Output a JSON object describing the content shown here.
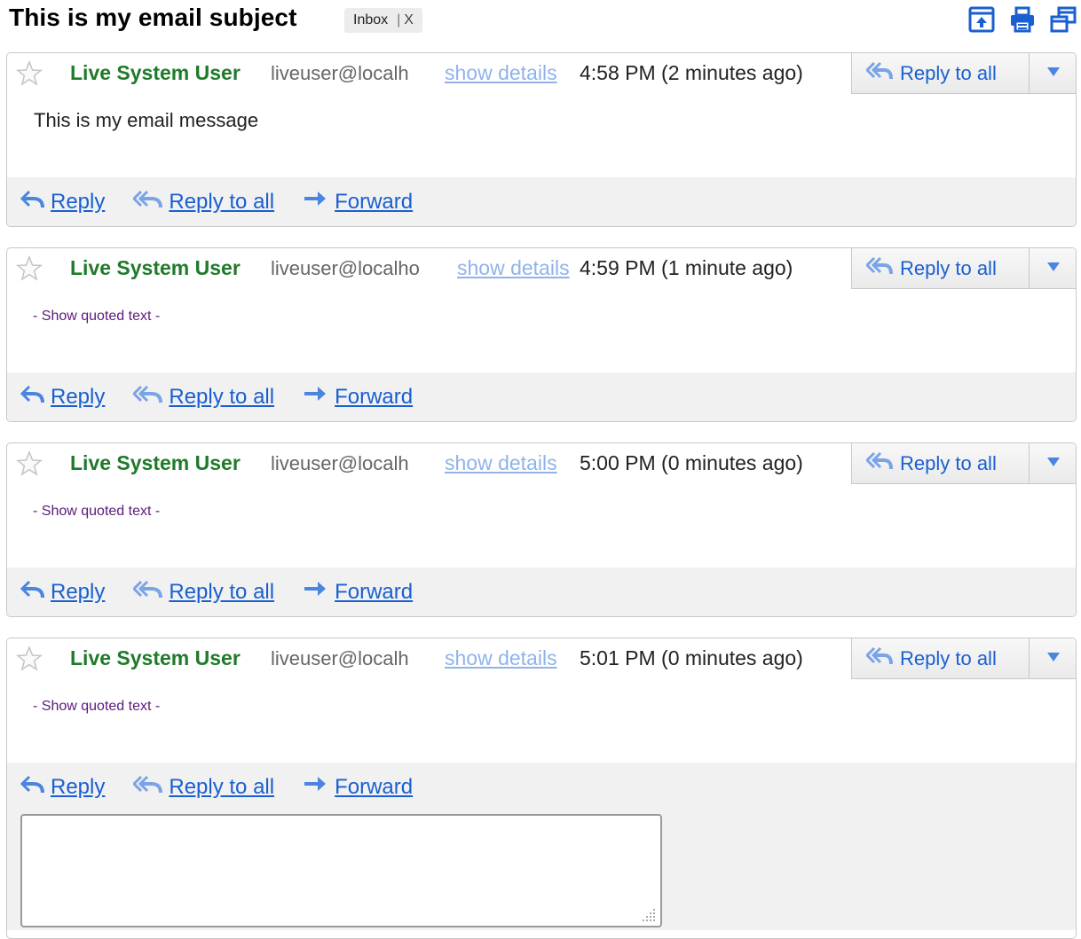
{
  "thread": {
    "subject": "This is my email subject",
    "label": "Inbox",
    "label_remove": "X"
  },
  "header_icons": [
    "archive-icon",
    "print-icon",
    "new-window-icon"
  ],
  "messages": [
    {
      "starred": false,
      "sender": "Live System User",
      "email": "liveuser@localh",
      "show_details": "show details",
      "time": "4:58 PM (2 minutes ago)",
      "body": "This is my email message",
      "quoted": "",
      "reply_all_button": "Reply to all"
    },
    {
      "starred": false,
      "sender": "Live System User",
      "email": "liveuser@localho",
      "show_details": "show details",
      "time": "4:59 PM (1 minute ago)",
      "body": "",
      "quoted": "- Show quoted text -",
      "reply_all_button": "Reply to all"
    },
    {
      "starred": false,
      "sender": "Live System User",
      "email": "liveuser@localh",
      "show_details": "show details",
      "time": "5:00 PM (0 minutes ago)",
      "body": "",
      "quoted": "- Show quoted text -",
      "reply_all_button": "Reply to all"
    },
    {
      "starred": false,
      "sender": "Live System User",
      "email": "liveuser@localh",
      "show_details": "show details",
      "time": "5:01 PM (0 minutes ago)",
      "body": "",
      "quoted": "- Show quoted text -",
      "reply_all_button": "Reply to all"
    }
  ],
  "actions": {
    "reply": "Reply",
    "reply_all": "Reply to all",
    "forward": "Forward"
  },
  "compose": {
    "value": "",
    "placeholder": ""
  },
  "colors": {
    "sender": "#1f7a2a",
    "link": "#1a5fd0",
    "details_link": "#8fb3ea",
    "quoted": "#5b1b7a",
    "icon_blue": "#1a5fd0",
    "action_bar": "#f1f1f1"
  }
}
